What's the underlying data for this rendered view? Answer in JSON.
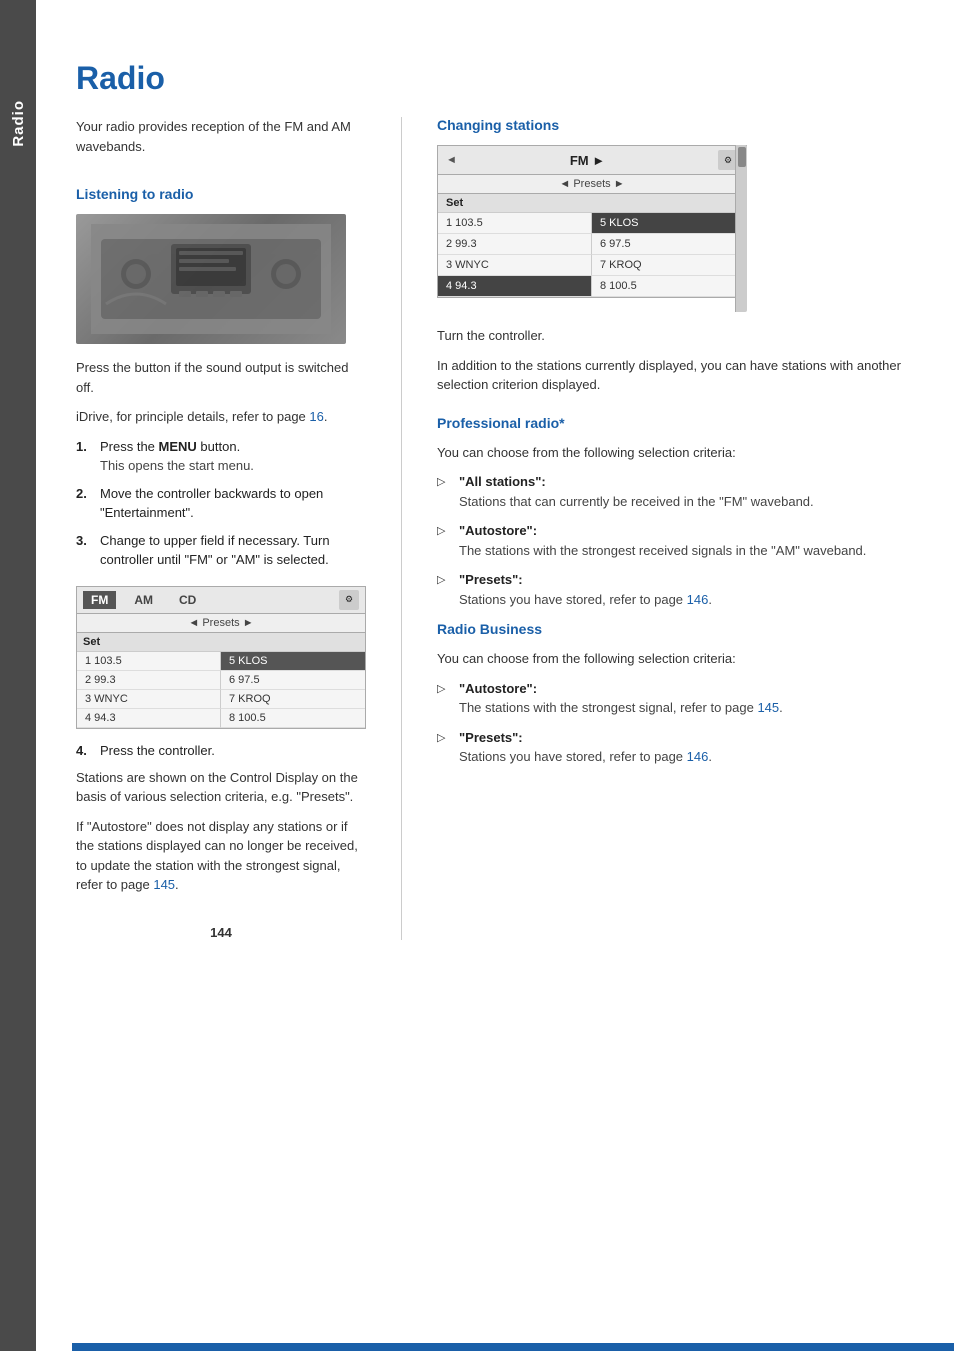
{
  "page": {
    "number": "144",
    "title": "Radio"
  },
  "side_tab": {
    "label": "Radio"
  },
  "intro": {
    "text": "Your radio provides reception of the FM and AM wavebands."
  },
  "listening_section": {
    "heading": "Listening to radio",
    "press_button_text": "Press the button if the sound output is switched off.",
    "idrive_text": "iDrive, for principle details, refer to page",
    "idrive_page": "16",
    "steps": [
      {
        "num": "1.",
        "main": "Press the",
        "menu_label": "MENU",
        "after": "button.",
        "sub": "This opens the start menu."
      },
      {
        "num": "2.",
        "main": "Move the controller backwards to open \"Entertainment\".",
        "sub": ""
      },
      {
        "num": "3.",
        "main": "Change to upper field if necessary. Turn controller until \"FM\" or \"AM\" is selected.",
        "sub": ""
      }
    ],
    "step4": {
      "num": "4.",
      "text": "Press the controller."
    },
    "stations_para1": "Stations are shown on the Control Display on the basis of various selection criteria, e.g. \"Presets\".",
    "stations_para2": "If \"Autostore\" does not display any stations or if the stations displayed can no longer be received, to update the station with the strongest signal, refer to page",
    "stations_page": "145"
  },
  "radio_display_small": {
    "tabs": [
      "FM",
      "AM",
      "CD"
    ],
    "active_tab": "FM",
    "presets_label": "◄ Presets ►",
    "set_label": "Set",
    "stations": [
      {
        "num": "1",
        "name": "103.5",
        "side": "left"
      },
      {
        "num": "5",
        "name": "KLOS",
        "side": "right"
      },
      {
        "num": "2",
        "name": "99.3",
        "side": "left"
      },
      {
        "num": "6",
        "name": "97.5",
        "side": "right"
      },
      {
        "num": "3",
        "name": "WNYC",
        "side": "left"
      },
      {
        "num": "7",
        "name": "KROQ",
        "side": "right"
      },
      {
        "num": "4",
        "name": "94.3",
        "side": "left"
      },
      {
        "num": "8",
        "name": "100.5",
        "side": "right"
      }
    ]
  },
  "changing_stations": {
    "heading": "Changing stations",
    "fm_label": "FM",
    "presets_label": "◄ Presets ►",
    "set_label": "Set",
    "turn_controller_text": "Turn the controller.",
    "additional_text": "In addition to the stations currently displayed, you can have stations with another selection criterion displayed.",
    "stations": [
      {
        "num": "1",
        "name": "103.5",
        "side": "left"
      },
      {
        "num": "5",
        "name": "KLOS",
        "side": "right",
        "highlight": true
      },
      {
        "num": "2",
        "name": "99.3",
        "side": "left"
      },
      {
        "num": "6",
        "name": "97.5",
        "side": "right"
      },
      {
        "num": "3",
        "name": "WNYC",
        "side": "left"
      },
      {
        "num": "7",
        "name": "KROQ",
        "side": "right"
      },
      {
        "num": "4",
        "name": "94.3",
        "side": "left",
        "highlight": true
      },
      {
        "num": "8",
        "name": "100.5",
        "side": "right"
      }
    ]
  },
  "professional_radio": {
    "heading": "Professional radio*",
    "intro": "You can choose from the following selection criteria:",
    "bullets": [
      {
        "title": "\"All stations\":",
        "desc": "Stations that can currently be received in the \"FM\" waveband."
      },
      {
        "title": "\"Autostore\":",
        "desc": "The stations with the strongest received signals in the \"AM\" waveband."
      },
      {
        "title": "\"Presets\":",
        "desc": "Stations you have stored, refer to page 146."
      }
    ],
    "presets_page": "146"
  },
  "radio_business": {
    "heading": "Radio Business",
    "intro": "You can choose from the following selection criteria:",
    "bullets": [
      {
        "title": "\"Autostore\":",
        "desc": "The stations with the strongest signal, refer to page 145."
      },
      {
        "title": "\"Presets\":",
        "desc": "Stations you have stored, refer to page 146."
      }
    ],
    "autostore_page": "145",
    "presets_page": "146"
  }
}
